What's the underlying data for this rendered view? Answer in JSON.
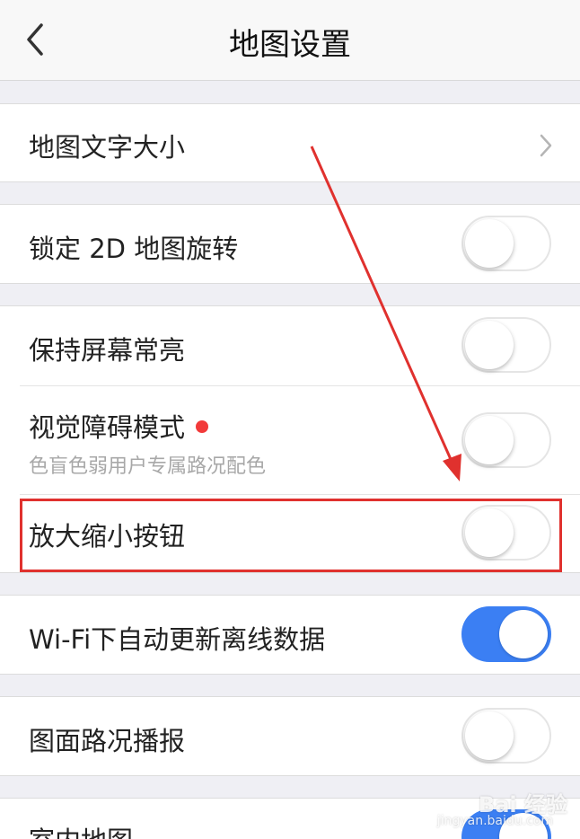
{
  "header": {
    "title": "地图设置",
    "back_icon": "chevron-left-icon"
  },
  "settings": {
    "map_text_size": {
      "label": "地图文字大小",
      "icon": "chevron-right-icon"
    },
    "lock_2d_rotation": {
      "label": "锁定 2D 地图旋转",
      "enabled": false
    },
    "keep_screen_on": {
      "label": "保持屏幕常亮",
      "enabled": false
    },
    "vision_mode": {
      "label": "视觉障碍模式",
      "sublabel": "色盲色弱用户专属路况配色",
      "enabled": false,
      "badge_color": "#f23a3a"
    },
    "zoom_buttons": {
      "label": "放大缩小按钮",
      "enabled": false
    },
    "wifi_auto_update": {
      "label": "Wi-Fi下自动更新离线数据",
      "enabled": true
    },
    "traffic_broadcast": {
      "label": "图面路况播报",
      "enabled": false
    },
    "indoor_map": {
      "label": "室内地图",
      "enabled": true
    }
  },
  "colors": {
    "toggle_on": "#3b7ff3",
    "annotation": "#e0312e"
  },
  "watermark": {
    "text": "Bai 经验",
    "sub": "jingyan.baidu.com"
  }
}
